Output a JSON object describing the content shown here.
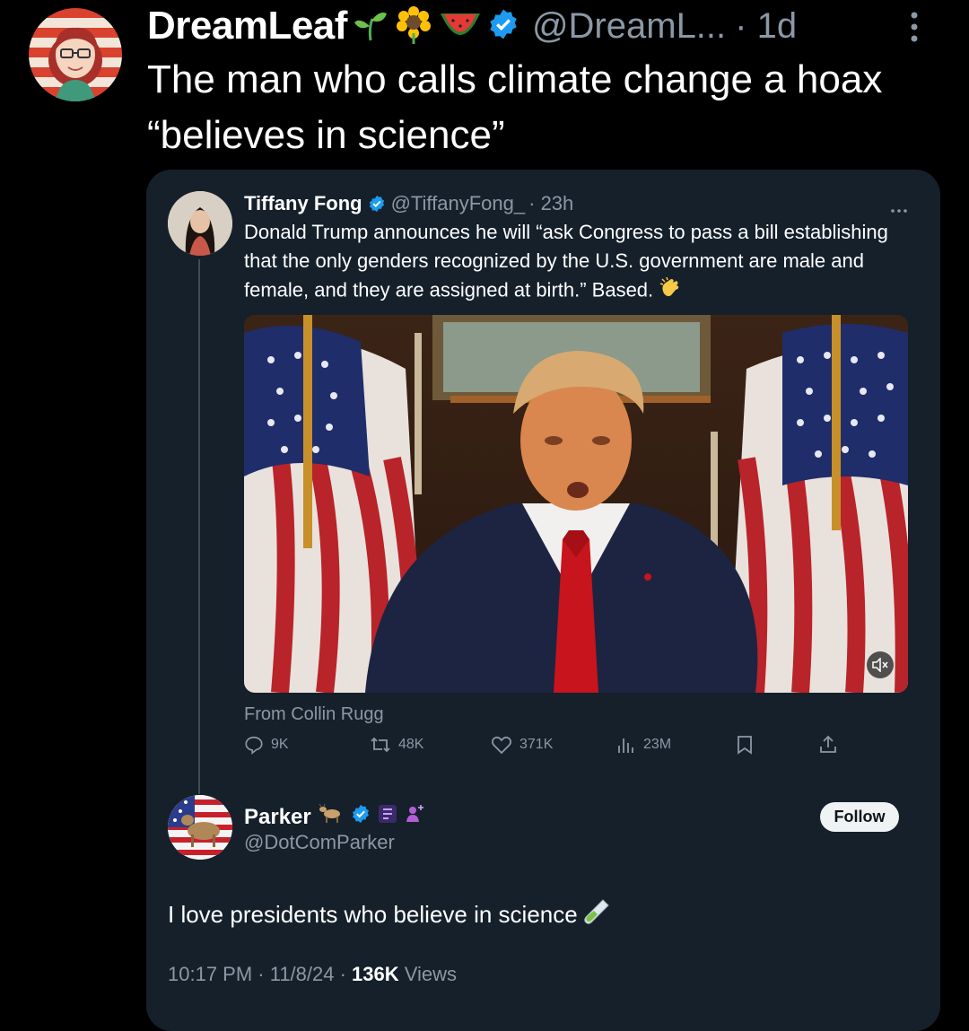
{
  "outer_tweet": {
    "display_name": "DreamLeaf",
    "handle": "@DreamL...",
    "time": "· 1d",
    "text_line1": "The man who calls climate change a hoax",
    "text_line2": "“believes in science”",
    "name_emojis": [
      "seedling-emoji",
      "sunflower-emoji",
      "watermelon-emoji"
    ]
  },
  "quoted_tweet": {
    "display_name": "Tiffany Fong",
    "handle": "@TiffanyFong_",
    "time": "· 23h",
    "text": "Donald Trump announces he will “ask Congress to pass a bill establishing that the only genders recognized by the U.S. government are male and female, and they are assigned at birth.” Based.",
    "media_attribution": "From Collin Rugg",
    "actions": {
      "replies": "9K",
      "reposts": "48K",
      "likes": "371K",
      "views": "23M"
    }
  },
  "reply_tweet": {
    "display_name": "Parker",
    "handle": "@DotComParker",
    "follow_label": "Follow",
    "text": "I love presidents who believe in science",
    "timestamp": "10:17 PM · 11/8/24 · ",
    "views_count": "136K",
    "views_label": " Views"
  },
  "colors": {
    "background": "#000000",
    "card": "#15202b",
    "verified": "#1d9bf0",
    "muted_text": "#8b98a5"
  }
}
